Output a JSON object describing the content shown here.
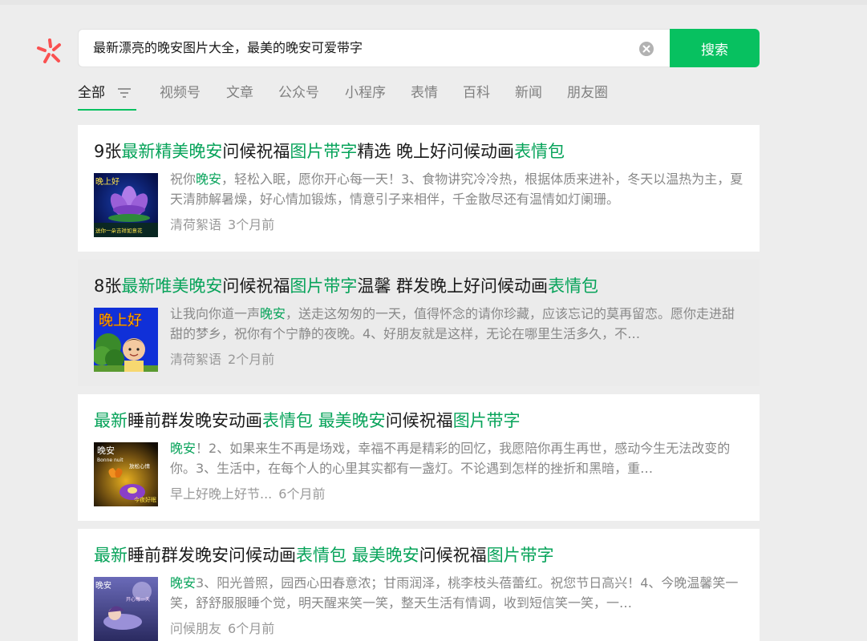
{
  "search": {
    "query": "最新漂亮的晚安图片大全，最美的晚安可爱带字",
    "button_label": "搜索"
  },
  "tabs": [
    {
      "label": "全部",
      "active": true
    },
    {
      "label": "视频号"
    },
    {
      "label": "文章"
    },
    {
      "label": "公众号"
    },
    {
      "label": "小程序"
    },
    {
      "label": "表情"
    },
    {
      "label": "百科"
    },
    {
      "label": "新闻"
    },
    {
      "label": "朋友圈"
    }
  ],
  "results": [
    {
      "title_parts": [
        {
          "t": "9张"
        },
        {
          "t": "最新精美晚安",
          "hl": true
        },
        {
          "t": "问候祝福"
        },
        {
          "t": "图片带字",
          "hl": true
        },
        {
          "t": "精选 晚上好问候动画"
        },
        {
          "t": "表情包",
          "hl": true
        }
      ],
      "desc_parts": [
        {
          "t": "祝你"
        },
        {
          "t": "晚安",
          "hl": true
        },
        {
          "t": "，轻松入眠，愿你开心每一天！3、食物讲究冷冷热，根据体质来进补，冬天以温热为主，夏天清肺解暑燥，好心情加锻炼，情意引子来相伴，千金散尽还有温情如灯阑珊。"
        }
      ],
      "source": "清荷絮语",
      "time": "3个月前",
      "thumb_icon": "lotus-image",
      "thumb_text": {
        "top": "晚上好",
        "bottom": "送你一朵吉祥如意花"
      }
    },
    {
      "title_parts": [
        {
          "t": "8张"
        },
        {
          "t": "最新唯美晚安",
          "hl": true
        },
        {
          "t": "问候祝福"
        },
        {
          "t": "图片带字",
          "hl": true
        },
        {
          "t": "温馨 群发晚上好问候动画"
        },
        {
          "t": "表情包",
          "hl": true
        }
      ],
      "desc_parts": [
        {
          "t": "让我向你道一声"
        },
        {
          "t": "晚安",
          "hl": true
        },
        {
          "t": "，送走这匆匆的一天，值得怀念的请你珍藏，应该忘记的莫再留恋。愿你走进甜甜的梦乡，祝你有个宁静的夜晚。4、好朋友就是这样，无论在哪里生活多久，不…"
        }
      ],
      "source": "清荷絮语",
      "time": "2个月前",
      "thumb_icon": "child-image",
      "thumb_text": {
        "top": "晚上好",
        "bottom": ""
      }
    },
    {
      "title_parts": [
        {
          "t": "最新",
          "hl": true
        },
        {
          "t": "睡前群发晚安动画"
        },
        {
          "t": "表情包",
          "hl": true
        },
        {
          "t": " "
        },
        {
          "t": "最美晚安",
          "hl": true
        },
        {
          "t": "问候祝福"
        },
        {
          "t": "图片带字",
          "hl": true
        }
      ],
      "desc_parts": [
        {
          "t": "晚安",
          "hl": true
        },
        {
          "t": "！2、如果来生不再是场戏，幸福不再是精彩的回忆，我愿陪你再生再世，感动今生无法改变的你。3、生活中，在每个人的心里其实都有一盏灯。不论遇到怎样的挫折和黑暗，重…"
        }
      ],
      "source": "早上好晚上好节...",
      "time": "6个月前",
      "thumb_icon": "butterfly-image",
      "thumb_text": {
        "top": "晚安",
        "sub": "Bonne nuit",
        "side": "放松心情",
        "bottom": "今夜好眠"
      }
    },
    {
      "title_parts": [
        {
          "t": "最新",
          "hl": true
        },
        {
          "t": "睡前群发晚安问候动画"
        },
        {
          "t": "表情包",
          "hl": true
        },
        {
          "t": " "
        },
        {
          "t": "最美晚安",
          "hl": true
        },
        {
          "t": "问候祝福"
        },
        {
          "t": "图片带字",
          "hl": true
        }
      ],
      "desc_parts": [
        {
          "t": "晚安",
          "hl": true
        },
        {
          "t": "3、阳光普照，园西心田春意浓；甘雨润泽，桃李枝头蓓蕾红。祝您节日高兴！4、今晚温馨笑一笑，舒舒服服睡个觉，明天醒来笑一笑，整天生活有情调，收到短信笑一笑，一…"
        }
      ],
      "source": "问候朋友",
      "time": "6个月前",
      "thumb_icon": "fairy-image",
      "thumb_text": {
        "top": "晚安",
        "side": "开心每一天"
      }
    }
  ],
  "colors": {
    "accent": "#07c160",
    "highlight": "#07a35a",
    "background": "#ededed"
  }
}
